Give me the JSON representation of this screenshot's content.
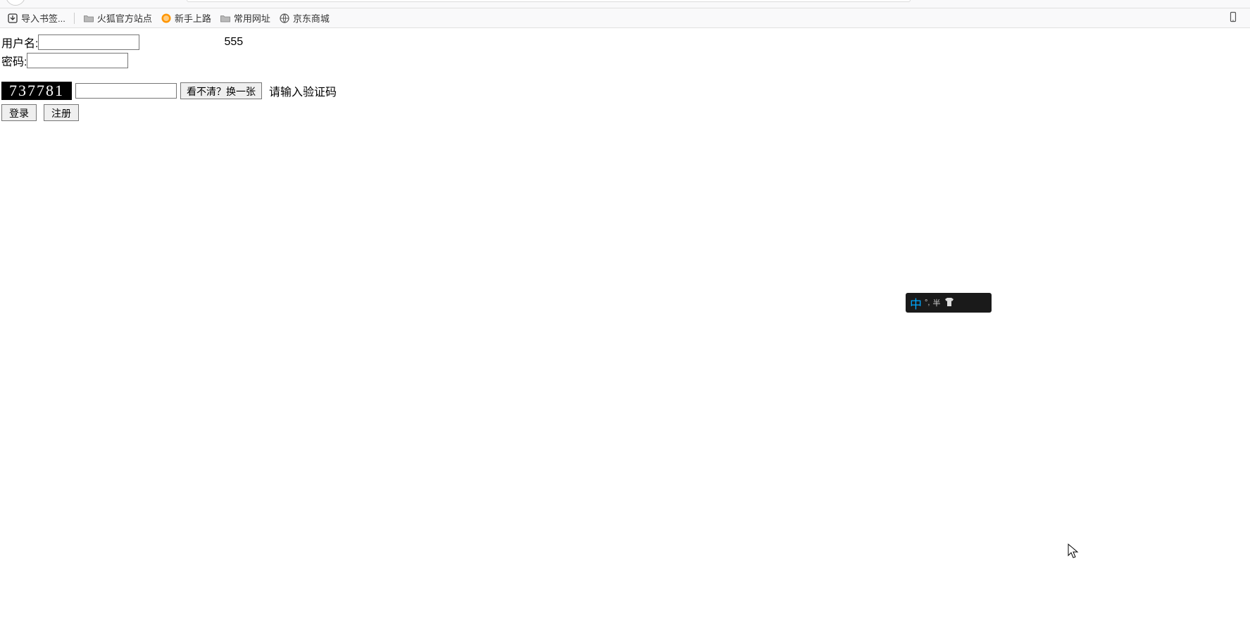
{
  "bookmarks": {
    "import": "导入书签...",
    "firefox_official": "火狐官方站点",
    "getting_started": "新手上路",
    "common_sites": "常用网址",
    "jd": "京东商城"
  },
  "form": {
    "username_label": "用户名:",
    "username_value": "",
    "side_value": "555",
    "password_label": "密码:",
    "password_value": ""
  },
  "captcha": {
    "code": "737781",
    "input_value": "",
    "refresh_label": "看不清？换一张",
    "hint": "请输入验证码"
  },
  "actions": {
    "login": "登录",
    "register": "注册"
  },
  "ime": {
    "mode": "中",
    "punct": "°,",
    "width": "半"
  }
}
